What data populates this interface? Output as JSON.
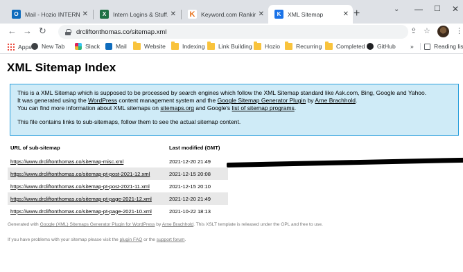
{
  "browser": {
    "tabs": [
      {
        "title": "Mail - Hozio INTERN - O",
        "favicon_color": "#0f6cbd",
        "favicon_text": "O"
      },
      {
        "title": "Intern Logins & Stuff.xlsx",
        "favicon_color": "#1e7145",
        "favicon_text": "X"
      },
      {
        "title": "Keyword.com Ranking R",
        "favicon_color": "#e8eaed",
        "favicon_text": "K"
      },
      {
        "title": "XML Sitemap",
        "favicon_color": "#1a73e8",
        "favicon_text": "K"
      }
    ],
    "active_tab": 3,
    "url": "drcliftonthomas.co/sitemap.xml",
    "bookmarks": {
      "apps": "Apps",
      "new_tab": "New Tab",
      "slack": "Slack",
      "mail": "Mail",
      "website": "Website",
      "indexing": "Indexing",
      "link_building": "Link Building",
      "hozio": "Hozio",
      "recurring": "Recurring",
      "completed": "Completed",
      "github": "GitHub",
      "more": "»",
      "reading_list": "Reading list"
    }
  },
  "page": {
    "title": "XML Sitemap Index",
    "intro": {
      "line1": "This is a XML Sitemap which is supposed to be processed by search engines which follow the XML Sitemap standard like Ask.com, Bing, Google and Yahoo.",
      "line2_a": "It was generated using the ",
      "line2_link1": "WordPress",
      "line2_b": " content management system and the ",
      "line2_link2": "Google Sitemap Generator Plugin",
      "line2_c": " by ",
      "line2_link3": "Arne Brachhold",
      "line2_d": ".",
      "line3_a": "You can find more information about XML sitemaps on ",
      "line3_link1": "sitemaps.org",
      "line3_b": " and Google's ",
      "line3_link2": "list of sitemap programs",
      "line3_c": ".",
      "line4": "This file contains links to sub-sitemaps, follow them to see the actual sitemap content."
    },
    "table": {
      "headers": [
        "URL of sub-sitemap",
        "Last modified (GMT)"
      ],
      "rows": [
        {
          "url": "https://www.drcliftonthomas.co/sitemap-misc.xml",
          "modified": "2021-12-20 21:49"
        },
        {
          "url": "https://www.drcliftonthomas.co/sitemap-pt-post-2021-12.xml",
          "modified": "2021-12-15 20:08"
        },
        {
          "url": "https://www.drcliftonthomas.co/sitemap-pt-post-2021-11.xml",
          "modified": "2021-12-15 20:10"
        },
        {
          "url": "https://www.drcliftonthomas.co/sitemap-pt-page-2021-12.xml",
          "modified": "2021-12-20 21:49"
        },
        {
          "url": "https://www.drcliftonthomas.co/sitemap-pt-page-2021-10.xml",
          "modified": "2021-10-22 18:13"
        }
      ]
    },
    "footer1": {
      "a": "Generated with ",
      "link1": "Google (XML) Sitemaps Generator Plugin for WordPress",
      "b": " by ",
      "link2": "Arne Brachhold",
      "c": ". This XSLT template is released under the GPL and free to use."
    },
    "footer2": {
      "a": "If you have problems with your sitemap please visit the ",
      "link1": "plugin FAQ",
      "b": " or the ",
      "link2": "support forum",
      "c": "."
    }
  }
}
